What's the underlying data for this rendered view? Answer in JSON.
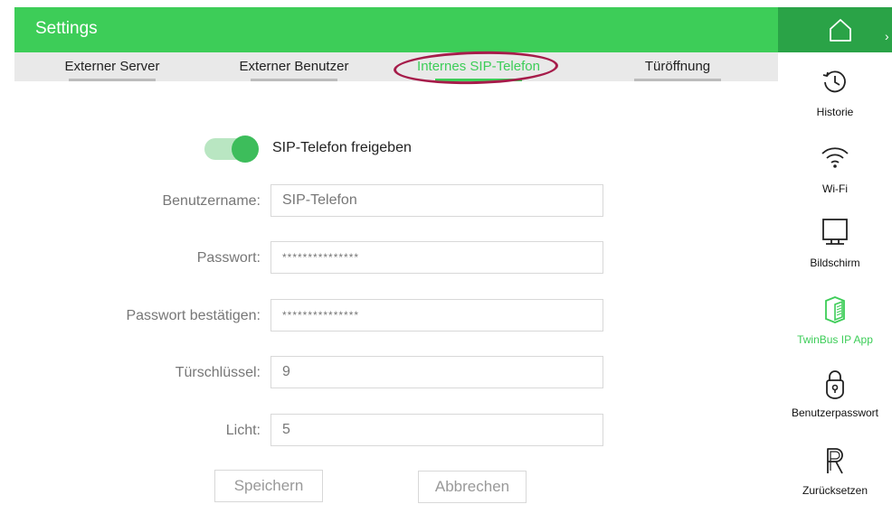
{
  "header": {
    "title": "Settings"
  },
  "tabs": [
    {
      "label": "Externer Server",
      "active": false
    },
    {
      "label": "Externer Benutzer",
      "active": false
    },
    {
      "label": "Internes SIP-Telefon",
      "active": true
    },
    {
      "label": "Türöffnung",
      "active": false
    }
  ],
  "form": {
    "toggle": {
      "label": "SIP-Telefon freigeben",
      "enabled": true
    },
    "fields": [
      {
        "label": "Benutzername:",
        "value": "SIP-Telefon"
      },
      {
        "label": "Passwort:",
        "value": "***************"
      },
      {
        "label": "Passwort bestätigen:",
        "value": "***************"
      },
      {
        "label": "Türschlüssel:",
        "value": "9"
      },
      {
        "label": "Licht:",
        "value": "5"
      }
    ],
    "save_label": "Speichern",
    "cancel_label": "Abbrechen"
  },
  "sidebar": {
    "home_icon": "home-icon",
    "items": [
      {
        "label": "Historie",
        "icon": "history-icon",
        "active": false
      },
      {
        "label": "Wi-Fi",
        "icon": "wifi-icon",
        "active": false
      },
      {
        "label": "Bildschirm",
        "icon": "monitor-icon",
        "active": false
      },
      {
        "label": "TwinBus IP App",
        "icon": "twinbus-app-icon",
        "active": true
      },
      {
        "label": "Benutzerpasswort",
        "icon": "lock-icon",
        "active": false
      },
      {
        "label": "Zurücksetzen",
        "icon": "reset-icon",
        "active": false
      }
    ]
  },
  "colors": {
    "brand_green": "#3dcd58",
    "dark_green": "#2aa347",
    "highlight_ring": "#a61c4a"
  }
}
